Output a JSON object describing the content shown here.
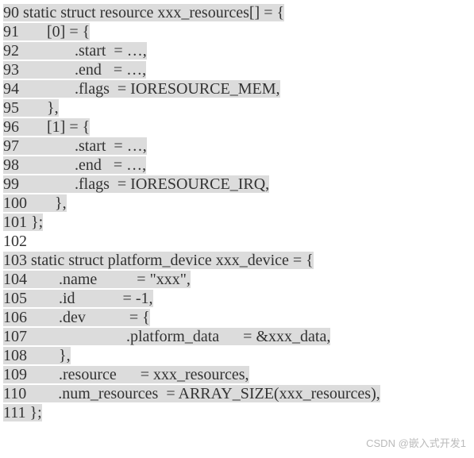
{
  "lines": [
    {
      "num": "90",
      "text": " static struct resource xxx_resources[] = {",
      "plain": false
    },
    {
      "num": "91",
      "text": "       [0] = {",
      "plain": false
    },
    {
      "num": "92",
      "text": "              .start  = …,",
      "plain": false
    },
    {
      "num": "93",
      "text": "              .end   = …,",
      "plain": false
    },
    {
      "num": "94",
      "text": "              .flags  = IORESOURCE_MEM,",
      "plain": false
    },
    {
      "num": "95",
      "text": "       },",
      "plain": false
    },
    {
      "num": "96",
      "text": "       [1] = {",
      "plain": false
    },
    {
      "num": "97",
      "text": "              .start  = …,",
      "plain": false
    },
    {
      "num": "98",
      "text": "              .end   = …,",
      "plain": false
    },
    {
      "num": "99",
      "text": "              .flags  = IORESOURCE_IRQ,",
      "plain": false
    },
    {
      "num": "100",
      "text": "       },",
      "plain": false
    },
    {
      "num": "101",
      "text": " };",
      "plain": false
    },
    {
      "num": "102",
      "text": "",
      "plain": true
    },
    {
      "num": "103",
      "text": " static struct platform_device xxx_device = {",
      "plain": false
    },
    {
      "num": "104",
      "text": "        .name          = \"xxx\",",
      "plain": false
    },
    {
      "num": "105",
      "text": "        .id            = -1,",
      "plain": false
    },
    {
      "num": "106",
      "text": "        .dev           = {",
      "plain": false
    },
    {
      "num": "107",
      "text": "                         .platform_data      = &xxx_data,",
      "plain": false
    },
    {
      "num": "108",
      "text": "        },",
      "plain": false
    },
    {
      "num": "109",
      "text": "        .resource      = xxx_resources,",
      "plain": false
    },
    {
      "num": "110",
      "text": "        .num_resources  = ARRAY_SIZE(xxx_resources),",
      "plain": false
    },
    {
      "num": "111",
      "text": " };",
      "plain": false
    }
  ],
  "watermark": "CSDN @嵌入式开发1"
}
